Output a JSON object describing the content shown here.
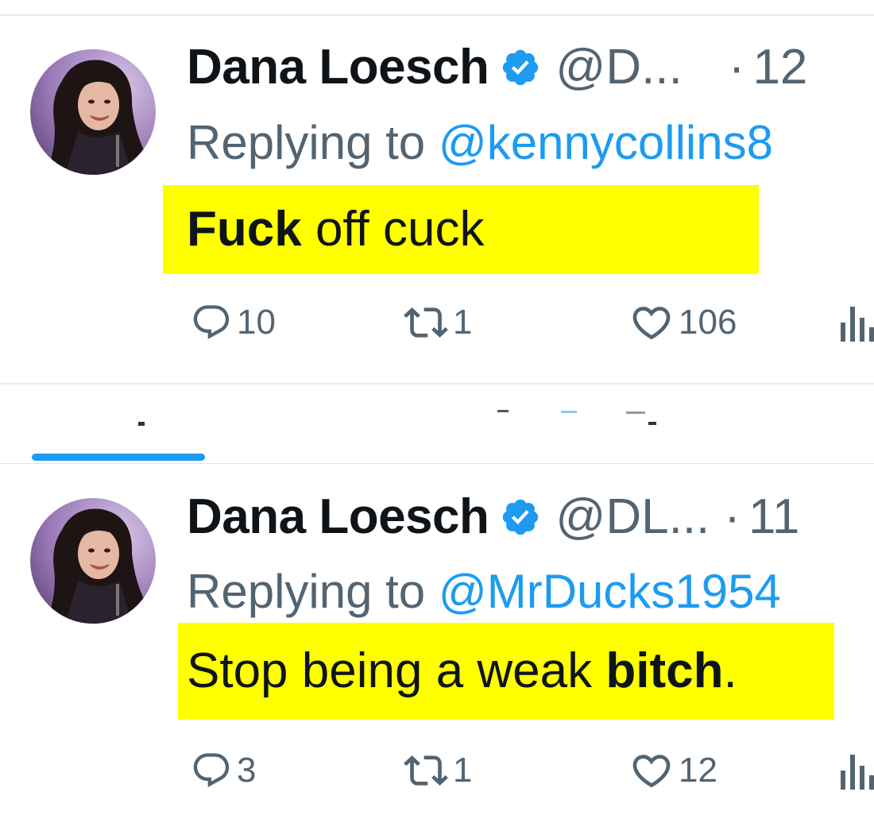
{
  "tweets": [
    {
      "display_name": "Dana Loesch",
      "handle": "@D...",
      "dot": "·",
      "time": "12",
      "replying_prefix": "Replying to ",
      "replying_to": "@kennycollins8",
      "text_bold": "Fuck",
      "text_rest": " off cuck",
      "replies": "10",
      "reposts": "1",
      "likes": "106"
    },
    {
      "display_name": "Dana Loesch",
      "handle": "@DL...",
      "dot": "·",
      "time": "11",
      "replying_prefix": "Replying to ",
      "replying_to": "@MrDucks1954",
      "text_before": "Stop being a weak ",
      "text_bold": "bitch",
      "text_after": ".",
      "replies": "3",
      "reposts": "1",
      "likes": "12"
    }
  ],
  "colors": {
    "highlight": "#ffff00",
    "link": "#1d9bf0",
    "muted": "#536471",
    "verified": "#1d9bf0"
  },
  "icons": [
    "verified-badge-icon",
    "reply-icon",
    "repost-icon",
    "like-icon",
    "views-icon"
  ]
}
